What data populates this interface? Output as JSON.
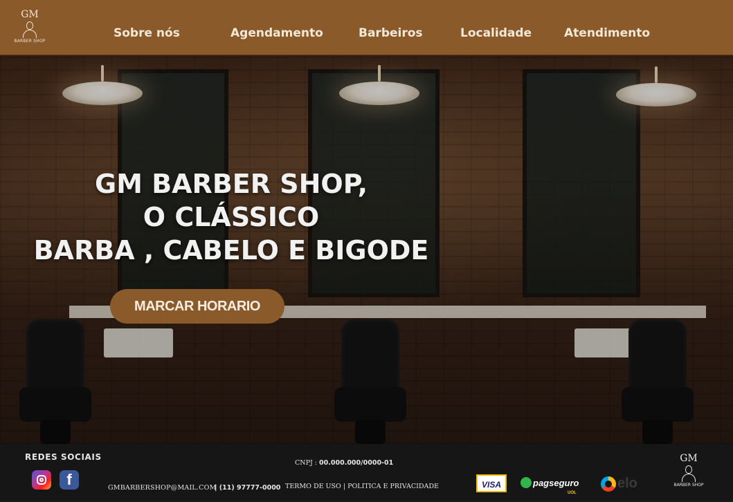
{
  "header": {
    "logo_monogram": "GM",
    "logo_subtitle": "BARBER SHOP",
    "nav": [
      {
        "label": "Sobre nós"
      },
      {
        "label": "Agendamento"
      },
      {
        "label": "Barbeiros"
      },
      {
        "label": "Localidade"
      },
      {
        "label": "Atendimento"
      }
    ]
  },
  "hero": {
    "title_lines": [
      "GM BARBER SHOP,",
      "O CLÁSSICO",
      "BARBA , CABELO E BIGODE"
    ],
    "cta_label": "MARCAR HORARIO"
  },
  "footer": {
    "social_title": "REDES SOCIAIS",
    "social_icons": [
      "instagram-icon",
      "facebook-icon"
    ],
    "facebook_glyph": "f",
    "email": "GMBARBERSHOP@MAIL.COM",
    "phone": "| (11) 97777-0000",
    "cnpj_label": "CNPJ :",
    "cnpj_value": "00.000.000/0000-01",
    "terms": "TERMO DE USO | POLITICA E PRIVACIDADE",
    "payments": {
      "visa": "VISA",
      "pagseguro": "pagseguro",
      "pagseguro_sub": "UOL",
      "elo": "elo"
    },
    "logo_monogram": "GM",
    "logo_subtitle": "BARBER SHOP"
  },
  "colors": {
    "brand_brown": "#8a5a2b",
    "footer_bg": "#161616",
    "nav_text": "#f5e8d6"
  }
}
